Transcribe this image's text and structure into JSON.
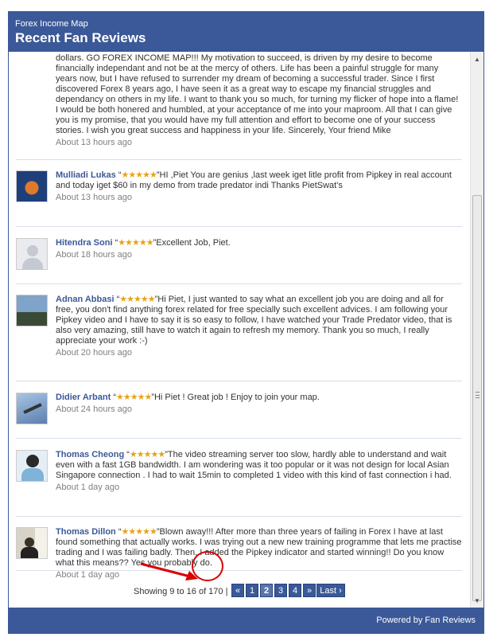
{
  "header": {
    "subtitle": "Forex Income Map",
    "title": "Recent Fan Reviews"
  },
  "reviews": [
    {
      "name": "",
      "stars": "",
      "text": "dollars. GO FOREX INCOME MAP!!! My motivation to succeed, is driven by my desire to become financially independant and not be at the mercy of others. Life has been a painful struggle for many years now, but I have refused to surrender my dream of becoming a successful trader. Since I first discovered Forex 8 years ago, I have seen it as a great way to escape my financial struggles and dependancy on others in my life. I want to thank you so much, for turning my flicker of hope into a flame! I would be both honered and humbled, at your acceptance of me into your maproom. All that I can give you is my promise, that you would have my full attention and effort to become one of your success stories. I wish you great success and happiness in your life. Sincerely, Your friend Mike",
      "time": "About 13 hours ago"
    },
    {
      "name": "Mulliadi Lukas",
      "stars": "★★★★★",
      "text": "HI ,Piet You are genius ,last week iget litle profit from Pipkey in real account and today iget $60 in my demo from trade predator indi Thanks PietSwat's",
      "time": "About 13 hours ago"
    },
    {
      "name": "Hitendra Soni",
      "stars": "★★★★★",
      "text": "Excellent Job, Piet.",
      "time": "About 18 hours ago"
    },
    {
      "name": "Adnan Abbasi",
      "stars": "★★★★★",
      "text": "Hi Piet, I just wanted to say what an excellent job you are doing and all for free, you don't find anything forex related for free specially such excellent advices. I am following your Pipkey video and I have to say it is so easy to follow, I have watched your Trade Predator video, that is also very amazing, still have to watch it again to refresh my memory. Thank you so much, I really appreciate your work :-)",
      "time": "About 20 hours ago"
    },
    {
      "name": "Didier Arbant",
      "stars": "★★★★★",
      "text": "Hi Piet ! Great job ! Enjoy to join your map.",
      "time": "About 24 hours ago"
    },
    {
      "name": "Thomas Cheong",
      "stars": "★★★★★",
      "text": "The video streaming server too slow, hardly able to understand and wait even with a fast 1GB bandwidth. I am wondering was it too popular or it was not design for local Asian Singapore connection . I had to wait 15min to completed 1 video with this kind of fast connection i had.",
      "time": "About 1 day ago"
    },
    {
      "name": "Thomas Dillon",
      "stars": "★★★★★",
      "text": "Blown away!!! After more than three years of failing in Forex I have at last found something that actually works. I was trying out a new new training programme that lets me practise trading and I was failing badly. Then, I added the Pipkey indicator and started winning!! Do you know what this means?? Yes you probably do.",
      "time": "About 1 day ago"
    }
  ],
  "pager": {
    "info": "Showing 9 to 16 of 170 |",
    "prev": "«",
    "p1": "1",
    "p2": "2",
    "p3": "3",
    "p4": "4",
    "next": "»",
    "last": "Last ›"
  },
  "footer": {
    "label": "Powered by Fan Reviews"
  },
  "colors": {
    "brand": "#3b5998",
    "star": "#e8a317",
    "annotation": "#d90000"
  }
}
